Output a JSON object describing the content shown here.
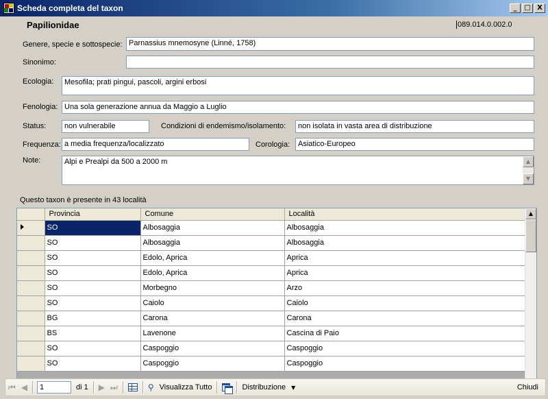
{
  "window": {
    "title": "Scheda completa del taxon",
    "min": "_",
    "max": "□",
    "close": "X"
  },
  "header": {
    "family": "Papilionidae",
    "code": "089.014.0.002.0"
  },
  "fields": {
    "genere_label": "Genere, specie e sottospecie:",
    "genere_value": "Parnassius mnemosyne (Linné, 1758)",
    "sinonimo_label": "Sinonimo:",
    "sinonimo_value": "",
    "ecologia_label": "Ecologia:",
    "ecologia_value": "Mesofila; prati pingui, pascoli, argini erbosi",
    "fenologia_label": "Fenologia:",
    "fenologia_value": "Una sola generazione annua da Maggio a Luglio",
    "status_label": "Status:",
    "status_value": "non vulnerabile",
    "endemismo_label": "Condizioni di endemismo/isolamento:",
    "endemismo_value": "non isolata in vasta area di distribuzione",
    "frequenza_label": "Frequenza:",
    "frequenza_value": "a media frequenza/localizzato",
    "corologia_label": "Corologia:",
    "corologia_value": "Asiatico-Europeo",
    "note_label": "Note:",
    "note_value": "Alpi e Prealpi da 500 a 2000 m"
  },
  "grid": {
    "caption": "Questo taxon è presente in 43 località",
    "columns": [
      "Provincia",
      "Comune",
      "Località"
    ],
    "rows": [
      [
        "SO",
        "Albosaggia",
        "Albosaggia"
      ],
      [
        "SO",
        "Albosaggia",
        "Albosaggia"
      ],
      [
        "SO",
        "Edolo, Aprica",
        "Aprica"
      ],
      [
        "SO",
        "Edolo, Aprica",
        "Aprica"
      ],
      [
        "SO",
        "Morbegno",
        "Arzo"
      ],
      [
        "SO",
        "Caiolo",
        "Caiolo"
      ],
      [
        "BG",
        "Carona",
        "Carona"
      ],
      [
        "BS",
        "Lavenone",
        "Cascina di Paio"
      ],
      [
        "SO",
        "Caspoggio",
        "Caspoggio"
      ],
      [
        "SO",
        "Caspoggio",
        "Caspoggio"
      ]
    ]
  },
  "toolbar": {
    "position": "1",
    "of_label": "di 1",
    "show_all_label": "Visualizza Tutto",
    "distribution_label": "Distribuzione",
    "close_label": "Chiudi"
  },
  "colors": {
    "titlebar": "#0a246a",
    "selection": "#0a246a",
    "face": "#d4d0c8"
  }
}
